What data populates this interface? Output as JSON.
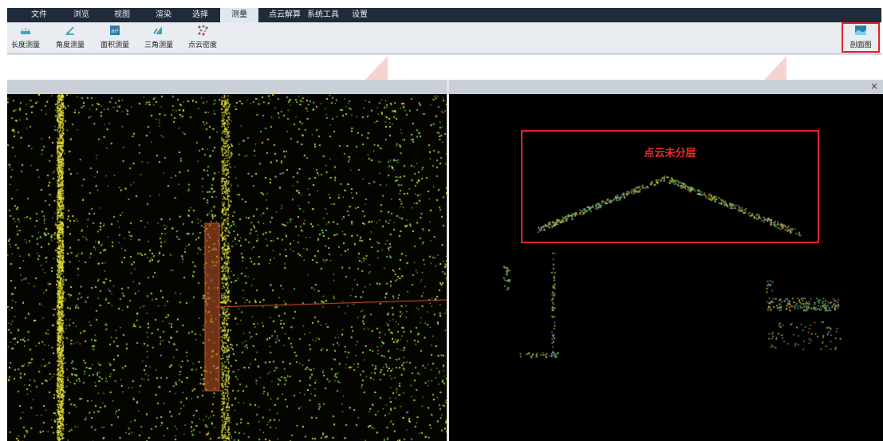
{
  "menu": {
    "items": [
      {
        "label": "文件"
      },
      {
        "label": "浏览"
      },
      {
        "label": "视图"
      },
      {
        "label": "渲染"
      },
      {
        "label": "选择"
      },
      {
        "label": "测量",
        "active": true
      },
      {
        "label": "点云解算"
      },
      {
        "label": "系统工具"
      },
      {
        "label": "设置"
      }
    ]
  },
  "toolbar": {
    "tools": [
      {
        "label": "长度测量",
        "icon": "ruler-icon"
      },
      {
        "label": "角度测量",
        "icon": "angle-icon"
      },
      {
        "label": "面积测量",
        "icon": "area-icon"
      },
      {
        "label": "三角测量",
        "icon": "triangle-icon"
      },
      {
        "label": "点云密度",
        "icon": "density-icon"
      }
    ],
    "profile": {
      "label": "剖面图",
      "icon": "profile-icon"
    }
  },
  "panels": {
    "right": {
      "close_label": "×"
    }
  },
  "annotation": {
    "label": "点云未分层"
  },
  "colors": {
    "menubar_bg": "#1f2b38",
    "active_tab_bg": "#dfe7ef",
    "highlight_red": "#e8202a",
    "viewport_bg": "#000000"
  }
}
